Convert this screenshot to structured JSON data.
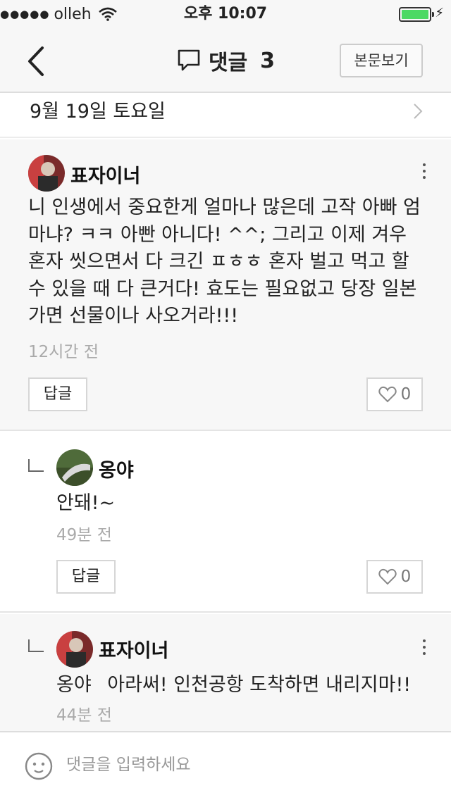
{
  "status": {
    "carrier": "olleh",
    "time": "오후 10:07"
  },
  "nav": {
    "title": "댓글",
    "count": "3",
    "view_post": "본문보기"
  },
  "post_date": "9월 19일 토요일",
  "comments": [
    {
      "author": "표자이너",
      "text": "니 인생에서 중요한게 얼마나 많은데 고작 아빠 엄마냐? ㅋㅋ 아빤 아니다! ^^; 그리고 이제 겨우 혼자 씻으면서 다 크긴 ㅍㅎㅎ 혼자 벌고 먹고 할 수 있을 때 다 큰거다! 효도는 필요없고 당장 일본가면 선물이나 사오거라!!!",
      "time": "12시간 전",
      "reply_label": "답글",
      "likes": "0"
    },
    {
      "author": "옹야",
      "text": "안돼!~",
      "time": "49분 전",
      "reply_label": "답글",
      "likes": "0"
    },
    {
      "author": "표자이너",
      "mention": "옹야",
      "text": "아라써! 인천공항 도착하면 내리지마!!",
      "time": "44분 전"
    }
  ],
  "input": {
    "placeholder": "댓글을 입력하세요"
  },
  "colors": {
    "battery": "#4cd964",
    "bg_gray": "#f7f7f7"
  }
}
